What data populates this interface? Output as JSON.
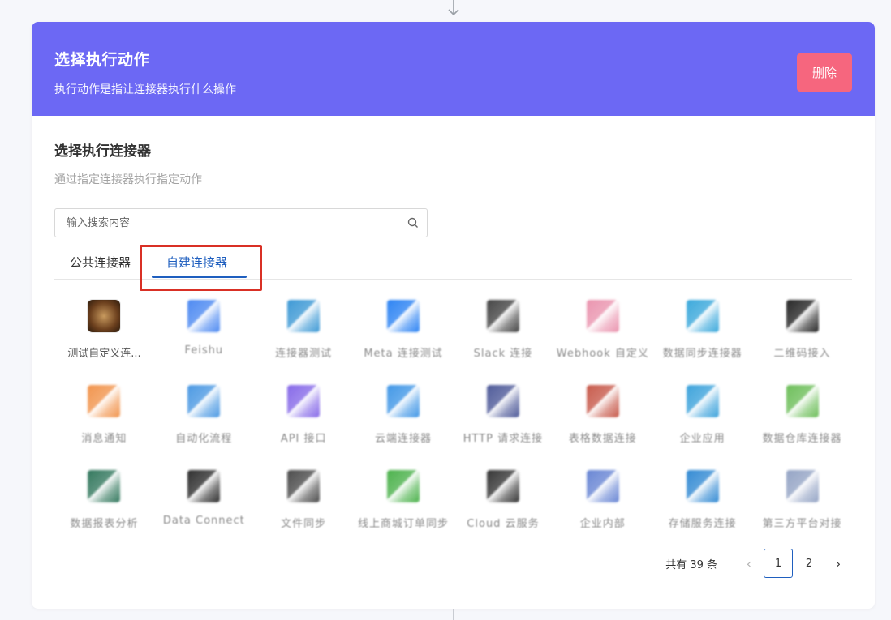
{
  "header": {
    "title": "选择执行动作",
    "subtitle": "执行动作是指让连接器执行什么操作",
    "delete_label": "删除",
    "bg_color": "#6c68f4",
    "delete_color": "#f6667e"
  },
  "section": {
    "title": "选择执行连接器",
    "description": "通过指定连接器执行指定动作"
  },
  "search": {
    "placeholder": "输入搜索内容",
    "value": "",
    "icon": "search-icon"
  },
  "tabs": [
    {
      "label": "公共连接器",
      "active": false
    },
    {
      "label": "自建连接器",
      "active": true
    }
  ],
  "connectors": [
    {
      "label": "测试自定义连...",
      "blurred": false,
      "icon_color": "#8a5a2b"
    },
    {
      "label": "Feishu",
      "blurred": true,
      "icon_color": "#3c7ef0"
    },
    {
      "label": "连接器测试",
      "blurred": true,
      "icon_color": "#2a8fd1"
    },
    {
      "label": "Meta 连接测试",
      "blurred": true,
      "icon_color": "#1877f2"
    },
    {
      "label": "Slack 连接",
      "blurred": true,
      "icon_color": "#333333"
    },
    {
      "label": "Webhook 自定义",
      "blurred": true,
      "icon_color": "#e88aa7"
    },
    {
      "label": "数据同步连接器",
      "blurred": true,
      "icon_color": "#28a0d8"
    },
    {
      "label": "二维码接入",
      "blurred": true,
      "icon_color": "#111111"
    },
    {
      "label": "消息通知",
      "blurred": true,
      "icon_color": "#f08a3c"
    },
    {
      "label": "自动化流程",
      "blurred": true,
      "icon_color": "#3a8fe0"
    },
    {
      "label": "API 接口",
      "blurred": true,
      "icon_color": "#7b5be6"
    },
    {
      "label": "云端连接器",
      "blurred": true,
      "icon_color": "#2f8de4"
    },
    {
      "label": "HTTP 请求连接",
      "blurred": true,
      "icon_color": "#3d4a8f"
    },
    {
      "label": "表格数据连接",
      "blurred": true,
      "icon_color": "#c24a3a"
    },
    {
      "label": "企业应用",
      "blurred": true,
      "icon_color": "#2a9ad8"
    },
    {
      "label": "数据仓库连接器",
      "blurred": true,
      "icon_color": "#5fb84a"
    },
    {
      "label": "数据报表分析",
      "blurred": true,
      "icon_color": "#1f6b4e"
    },
    {
      "label": "Data Connect",
      "blurred": true,
      "icon_color": "#1a1a1a"
    },
    {
      "label": "文件同步",
      "blurred": true,
      "icon_color": "#3a3a3a"
    },
    {
      "label": "线上商城订单同步",
      "blurred": true,
      "icon_color": "#3aaa3a"
    },
    {
      "label": "Cloud 云服务",
      "blurred": true,
      "icon_color": "#222222"
    },
    {
      "label": "企业内部",
      "blurred": true,
      "icon_color": "#5a7ad0"
    },
    {
      "label": "存储服务连接",
      "blurred": true,
      "icon_color": "#1f7fcf"
    },
    {
      "label": "第三方平台对接",
      "blurred": true,
      "icon_color": "#8a9bbf"
    }
  ],
  "pagination": {
    "total_text": "共有 39 条",
    "pages": [
      "1",
      "2"
    ],
    "current": "1",
    "prev": "‹",
    "next": "›"
  }
}
